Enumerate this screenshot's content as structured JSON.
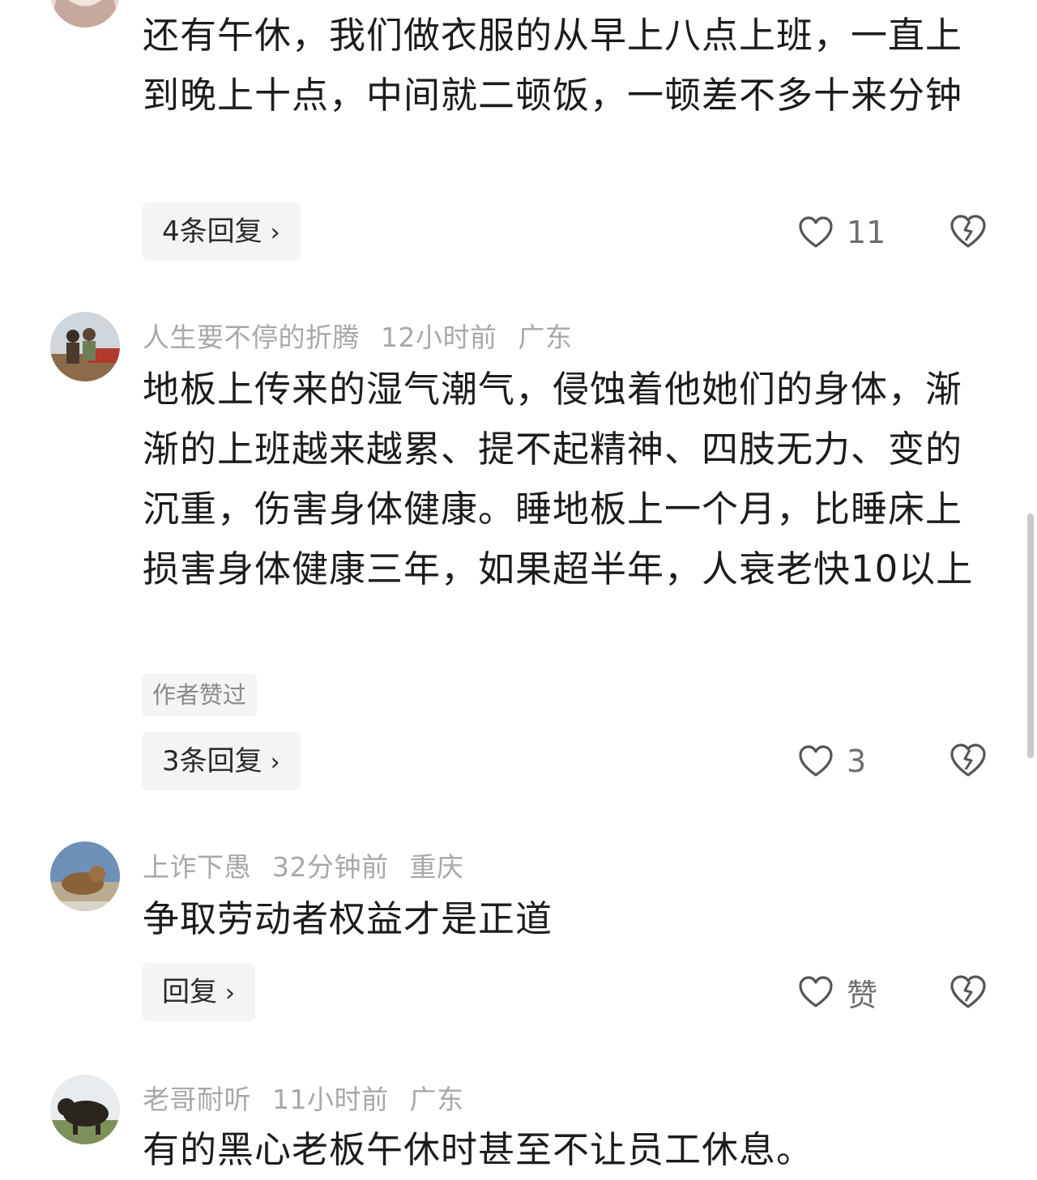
{
  "comments": [
    {
      "username": "",
      "time": "",
      "location": "",
      "text": "还有午休，我们做衣服的从早上八点上班，一直上到晚上十点，中间就二顿饭，一顿差不多十来分钟",
      "author_liked": "",
      "reply_label": "4条回复",
      "likes": "11"
    },
    {
      "username": "人生要不停的折腾",
      "time": "12小时前",
      "location": "广东",
      "text": "地板上传来的湿气潮气，侵蚀着他她们的身体，渐渐的上班越来越累、提不起精神、四肢无力、变的沉重，伤害身体健康。睡地板上一个月，比睡床上损害身体健康三年，如果超半年，人衰老快10以上",
      "author_liked": "作者赞过",
      "reply_label": "3条回复",
      "likes": "3"
    },
    {
      "username": "上诈下愚",
      "time": "32分钟前",
      "location": "重庆",
      "text": "争取劳动者权益才是正道",
      "author_liked": "",
      "reply_label": "回复",
      "likes": "赞"
    },
    {
      "username": "老哥耐听",
      "time": "11小时前",
      "location": "广东",
      "text": "有的黑心老板午休时甚至不让员工休息。",
      "author_liked": "",
      "reply_label": "",
      "likes": ""
    }
  ],
  "icons": {
    "like": "heart-outline-icon",
    "dislike": "broken-heart-icon",
    "chevron": "chevron-right-icon"
  },
  "chevron_glyph": "›",
  "colors": {
    "meta": "#a8a8a8",
    "pill_bg": "#f4f4f4",
    "text": "#1c1c1c"
  }
}
